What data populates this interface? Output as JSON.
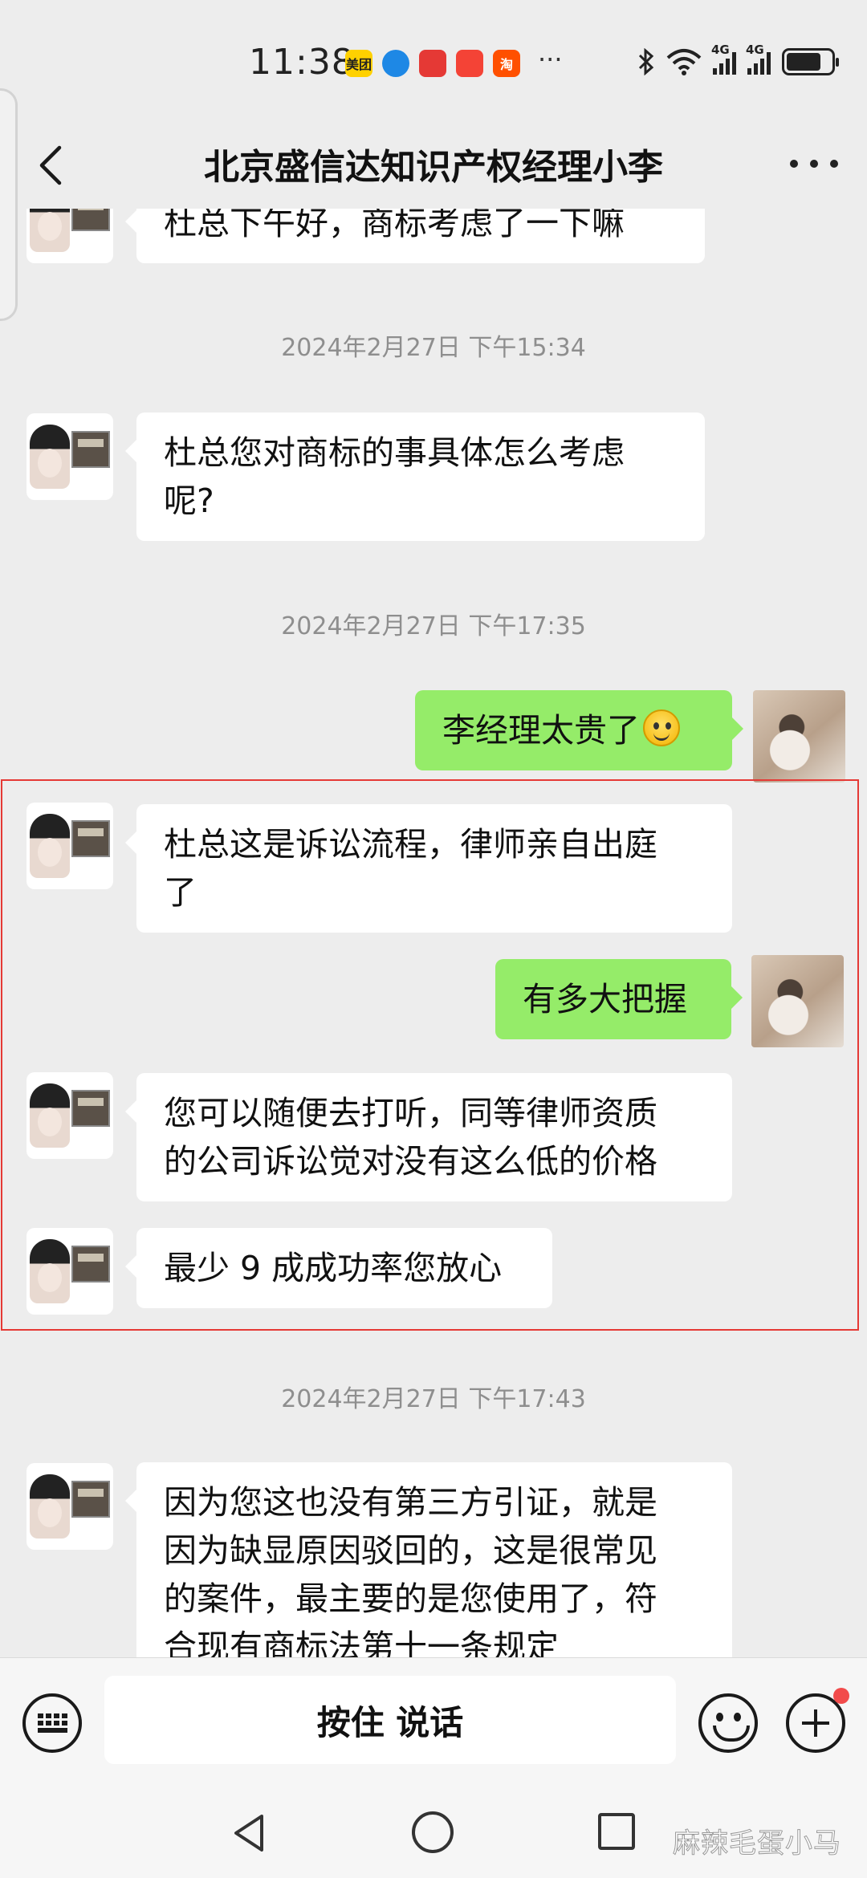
{
  "status_bar": {
    "time": "11:38",
    "app_icons": [
      {
        "name": "meituan",
        "label": "美团",
        "color": "#ffd100",
        "text_color": "#222222"
      },
      {
        "name": "browser",
        "label": "",
        "color": "#1e88e5",
        "text_color": "#ffffff"
      },
      {
        "name": "app-red",
        "label": "",
        "color": "#e53935",
        "text_color": "#ffffff"
      },
      {
        "name": "huawei-store",
        "label": "",
        "color": "#f44336",
        "text_color": "#ffffff"
      },
      {
        "name": "taobao",
        "label": "淘",
        "color": "#ff5000",
        "text_color": "#ffffff"
      }
    ],
    "overflow": "···",
    "network_1": "4G",
    "network_2": "4G",
    "battery_level": 0.78
  },
  "header": {
    "title": "北京盛信达知识产权经理小李"
  },
  "messages": [
    {
      "side": "in",
      "text": "杜总下午好，商标考虑了一下嘛"
    },
    {
      "type": "time",
      "text": "2024年2月27日 下午15:34"
    },
    {
      "side": "in",
      "text": "杜总您对商标的事具体怎么考虑\n呢?"
    },
    {
      "type": "time",
      "text": "2024年2月27日 下午17:35"
    },
    {
      "side": "out",
      "text": "李经理太贵了"
    },
    {
      "side": "in",
      "text": "杜总这是诉讼流程，律师亲自出庭\n了"
    },
    {
      "side": "out",
      "text": "有多大把握"
    },
    {
      "side": "in",
      "text": "您可以随便去打听，同等律师资质\n的公司诉讼觉对没有这么低的价格"
    },
    {
      "side": "in",
      "text": "最少 9 成成功率您放心"
    },
    {
      "type": "time",
      "text": "2024年2月27日 下午17:43"
    },
    {
      "side": "in",
      "text": "因为您这也没有第三方引证，就是\n因为缺显原因驳回的，这是很常见\n的案件，最主要的是您使用了，符\n合现有商标法第十一条规定"
    }
  ],
  "input_bar": {
    "hold_to_talk": "按住 说话",
    "has_notification": true
  },
  "watermark": "麻辣毛蛋小马",
  "colors": {
    "background": "#ededed",
    "incoming_bubble": "#ffffff",
    "outgoing_bubble": "#95ec69",
    "highlight_border": "#e53935",
    "timestamp": "#8e8e8e"
  }
}
